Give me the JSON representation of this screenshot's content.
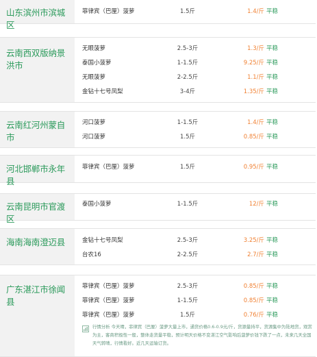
{
  "colors": {
    "region_text": "#2b9a5b",
    "price": "#f08133",
    "trend": "#2b9a5b",
    "region_bg": "#f2f2f2",
    "border": "#e3e3e3",
    "analysis_text": "#6a9a84"
  },
  "groups": [
    {
      "region": "山东滨州市滨城区",
      "rows": [
        {
          "name": "菲律宾（巴厘）菠萝",
          "spec": "1.5斤",
          "price": "1.4/斤",
          "trend": "平稳"
        }
      ]
    },
    {
      "region": "云南西双版纳景洪市",
      "rows": [
        {
          "name": "无眼菠萝",
          "spec": "2.5-3斤",
          "price": "1.3/斤",
          "trend": "平稳"
        },
        {
          "name": "泰国小菠萝",
          "spec": "1-1.5斤",
          "price": "9.25/斤",
          "trend": "平稳"
        },
        {
          "name": "无眼菠萝",
          "spec": "2-2.5斤",
          "price": "1.1/斤",
          "trend": "平稳"
        },
        {
          "name": "金钻十七号凤梨",
          "spec": "3-4斤",
          "price": "1.35/斤",
          "trend": "平稳"
        }
      ]
    },
    {
      "region": "云南红河州蒙自市",
      "rows": [
        {
          "name": "河口菠萝",
          "spec": "1-1.5斤",
          "price": "1.4/斤",
          "trend": "平稳"
        },
        {
          "name": "河口菠萝",
          "spec": "1.5斤",
          "price": "0.85/斤",
          "trend": "平稳"
        }
      ]
    },
    {
      "region": "河北邯郸市永年县",
      "rows": [
        {
          "name": "菲律宾（巴厘）菠萝",
          "spec": "1.5斤",
          "price": "0.95/斤",
          "trend": "平稳"
        }
      ]
    },
    {
      "region": "云南昆明市官渡区",
      "rows": [
        {
          "name": "泰国小菠萝",
          "spec": "1-1.5斤",
          "price": "12/斤",
          "trend": "平稳"
        }
      ]
    },
    {
      "region": "海南海南澄迈县",
      "rows": [
        {
          "name": "金钻十七号凤梨",
          "spec": "2.5-3斤",
          "price": "3.25/斤",
          "trend": "平稳"
        },
        {
          "name": "台农16",
          "spec": "2-2.5斤",
          "price": "2.7/斤",
          "trend": "平稳"
        }
      ]
    },
    {
      "region": "广东湛江市徐闻县",
      "rows": [
        {
          "name": "菲律宾（巴厘）菠萝",
          "spec": "2.5-3斤",
          "price": "0.85/斤",
          "trend": "平稳"
        },
        {
          "name": "菲律宾（巴厘）菠萝",
          "spec": "1-1.5斤",
          "price": "0.85/斤",
          "trend": "平稳"
        },
        {
          "name": "菲律宾（巴厘）菠萝",
          "spec": "1.5斤",
          "price": "0.76/斤",
          "trend": "平稳"
        }
      ],
      "analysis": "行情分析 今天晴，菲律宾（巴厘）菠萝大量上市，通货价格0.6-0.9元/斤，货源量持平，货源集中为陆地货，观赏为主，客商积极性一般，整体走货量平稳，预计明天价格不变湛江空气影响后菠萝价钱下跌了一点，未来几天全国天气转晴，行情看好。近几天运输订货。"
    }
  ]
}
